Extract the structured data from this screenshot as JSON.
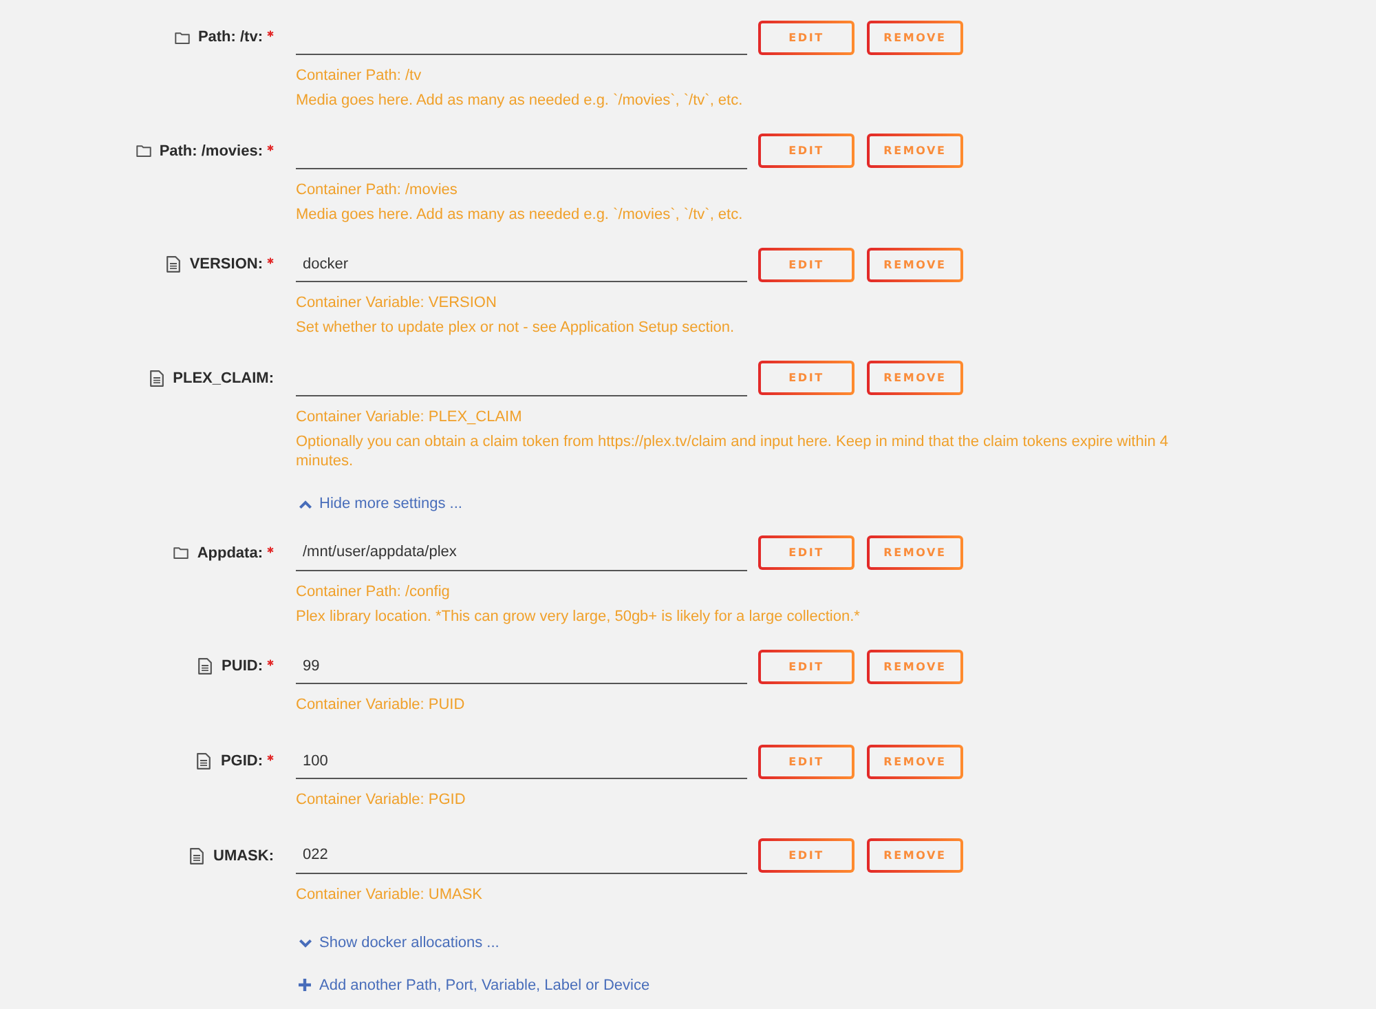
{
  "settings": [
    {
      "kind": "path",
      "label": "Path: /tv:",
      "required": true,
      "buttons": [
        "EDIT",
        "REMOVE"
      ],
      "help": [
        "Container Path: /tv",
        "Media goes here. Add as many as needed e.g. `/movies`, `/tv`, etc."
      ]
    },
    {
      "kind": "path",
      "label": "Path: /movies:",
      "required": true,
      "buttons": [
        "EDIT",
        "REMOVE"
      ],
      "help": [
        "Container Path: /movies",
        "Media goes here. Add as many as needed e.g. `/movies`, `/tv`, etc."
      ]
    },
    {
      "kind": "variable",
      "label": "VERSION:",
      "required": true,
      "value": "docker",
      "buttons": [
        "EDIT",
        "REMOVE"
      ],
      "help": [
        "Container Variable: VERSION",
        "Set whether to update plex or not - see Application Setup section."
      ]
    },
    {
      "kind": "variable",
      "label": "PLEX_CLAIM:",
      "required": false,
      "buttons": [
        "EDIT",
        "REMOVE"
      ],
      "help": [
        "Container Variable: PLEX_CLAIM",
        "Optionally you can obtain a claim token from https://plex.tv/claim and input here. Keep in mind that the claim tokens expire within 4 minutes."
      ]
    }
  ],
  "more_settings_toggle": {
    "label": "Hide more settings ...",
    "expanded": true
  },
  "more_settings": [
    {
      "kind": "path",
      "label": "Appdata:",
      "required": true,
      "value": "/mnt/user/appdata/plex",
      "buttons": [
        "EDIT",
        "REMOVE"
      ],
      "help": [
        "Container Path: /config",
        "Plex library location. *This can grow very large, 50gb+ is likely for a large collection.*"
      ]
    },
    {
      "kind": "variable",
      "label": "PUID:",
      "required": true,
      "value": "99",
      "buttons": [
        "EDIT",
        "REMOVE"
      ],
      "help": [
        "Container Variable: PUID"
      ]
    },
    {
      "kind": "variable",
      "label": "PGID:",
      "required": true,
      "value": "100",
      "buttons": [
        "EDIT",
        "REMOVE"
      ],
      "help": [
        "Container Variable: PGID"
      ]
    },
    {
      "kind": "variable",
      "label": "UMASK:",
      "required": false,
      "value": "022",
      "buttons": [
        "EDIT",
        "REMOVE"
      ],
      "help": [
        "Container Variable: UMASK"
      ]
    }
  ],
  "allocations_toggle": {
    "label": "Show docker allocations ...",
    "expanded": false
  },
  "add_link": {
    "label": "Add another Path, Port, Variable, Label or Device"
  }
}
